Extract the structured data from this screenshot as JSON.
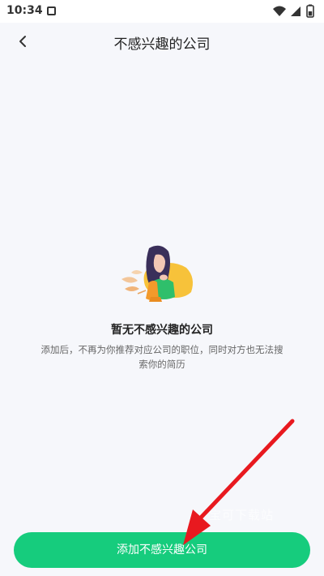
{
  "status_bar": {
    "time": "10:34",
    "icons": [
      "notification-icon",
      "wifi-icon",
      "signal-icon",
      "battery-icon"
    ]
  },
  "nav": {
    "back_icon": "chevron-left-icon",
    "title": "不感兴趣的公司"
  },
  "empty_state": {
    "illustration": "woman-thinking-illustration",
    "title": "暂无不感兴趣的公司",
    "description": "添加后，不再为你推荐对应公司的职位，同时对方也无法搜索你的简历"
  },
  "add_button": {
    "label": "添加不感兴趣公司"
  },
  "overlay": {
    "watermark": "宝可下载站",
    "arrow_color": "#e8191f"
  },
  "colors": {
    "accent": "#16cc7d",
    "background": "#f6f7fb"
  }
}
